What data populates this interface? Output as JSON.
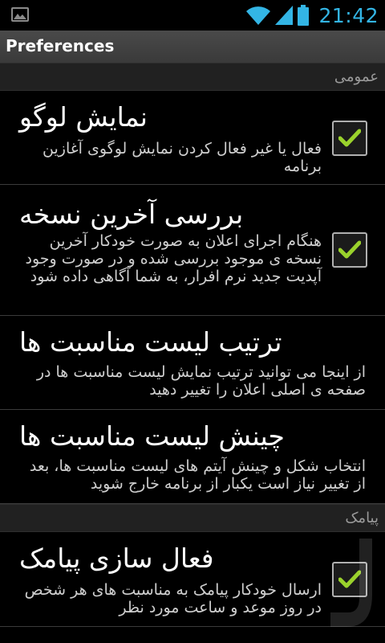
{
  "status_bar": {
    "time": "21:42",
    "icons": [
      "gallery-icon",
      "wifi-icon",
      "signal-icon",
      "battery-icon"
    ],
    "accent_color": "#33b5e5"
  },
  "app_bar": {
    "title": "Preferences"
  },
  "sections": [
    {
      "header": "عمومی",
      "items": [
        {
          "title": "نمایش لوگو",
          "summary": "فعال یا غیر فعال کردن نمایش لوگوی آغازین برنامه",
          "checked": true
        },
        {
          "title": "بررسی آخرین نسخه",
          "summary": "هنگام اجرای اعلان به صورت خودکار آخرین نسخه ی موجود بررسی شده و در صورت وجود آپدیت جدید نرم افرار، به شما آگاهی داده شود",
          "checked": true
        },
        {
          "title": "ترتیب لیست مناسبت ها",
          "summary": "از اینجا می توانید ترتیب نمایش لیست مناسبت ها در صفحه ی اصلی اعلان را تغییر دهید"
        },
        {
          "title": "چینش لیست مناسبت ها",
          "summary": "انتخاب شکل و چینش آیتم های لیست مناسبت ها، بعد از تغییر نیاز است یکبار از برنامه خارج شوید"
        }
      ]
    },
    {
      "header": "پیامک",
      "items": [
        {
          "title": "فعال سازی پیامک",
          "summary": "ارسال خودکار پیامک به مناسبت های هر شخص در روز موعد و ساعت مورد نظر",
          "checked": true
        }
      ]
    }
  ]
}
